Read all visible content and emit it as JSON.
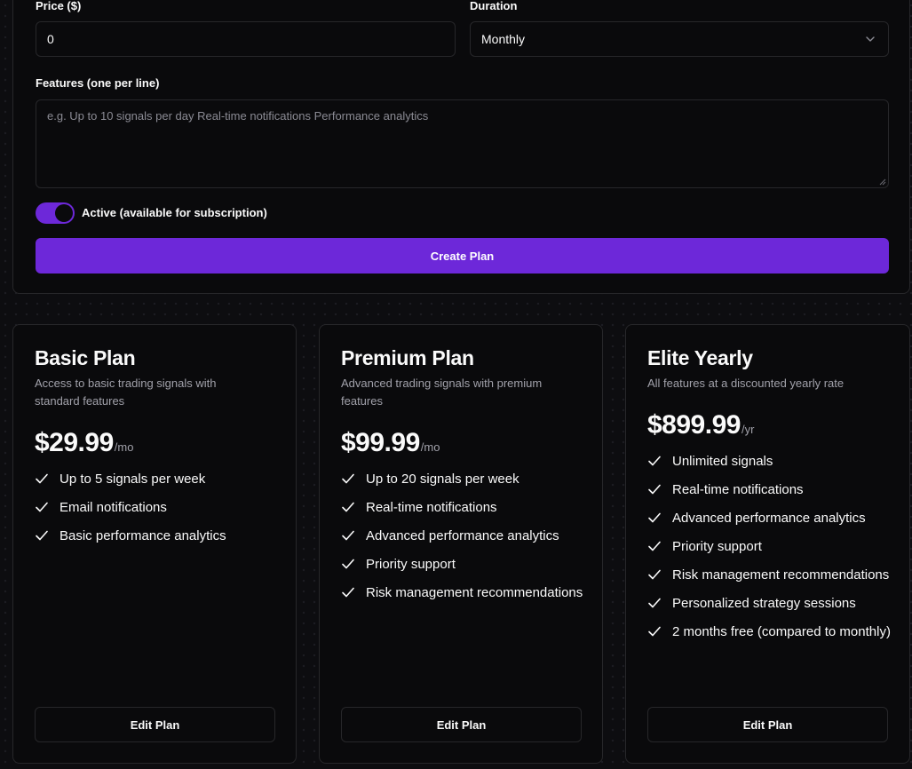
{
  "form": {
    "price_label": "Price ($)",
    "price_value": "0",
    "duration_label": "Duration",
    "duration_value": "Monthly",
    "features_label": "Features (one per line)",
    "features_placeholder": "e.g. Up to 10 signals per day Real-time notifications Performance analytics",
    "features_value": "",
    "active_label": "Active (available for subscription)",
    "active_on": true,
    "create_button": "Create Plan"
  },
  "plans": [
    {
      "name": "Basic Plan",
      "description": "Access to basic trading signals with standard features",
      "price": "$29.99",
      "period": "/mo",
      "features": [
        "Up to 5 signals per week",
        "Email notifications",
        "Basic performance analytics"
      ],
      "edit_button": "Edit Plan"
    },
    {
      "name": "Premium Plan",
      "description": "Advanced trading signals with premium features",
      "price": "$99.99",
      "period": "/mo",
      "features": [
        "Up to 20 signals per week",
        "Real-time notifications",
        "Advanced performance analytics",
        "Priority support",
        "Risk management recommendations"
      ],
      "edit_button": "Edit Plan"
    },
    {
      "name": "Elite Yearly",
      "description": "All features at a discounted yearly rate",
      "price": "$899.99",
      "period": "/yr",
      "features": [
        "Unlimited signals",
        "Real-time notifications",
        "Advanced performance analytics",
        "Priority support",
        "Risk management recommendations",
        "Personalized strategy sessions",
        "2 months free (compared to monthly)"
      ],
      "edit_button": "Edit Plan"
    }
  ],
  "colors": {
    "accent": "#6d28d9",
    "background": "#0d0d10",
    "card": "#0a0a0c",
    "border": "#27272a",
    "muted_text": "#a1a1aa"
  }
}
